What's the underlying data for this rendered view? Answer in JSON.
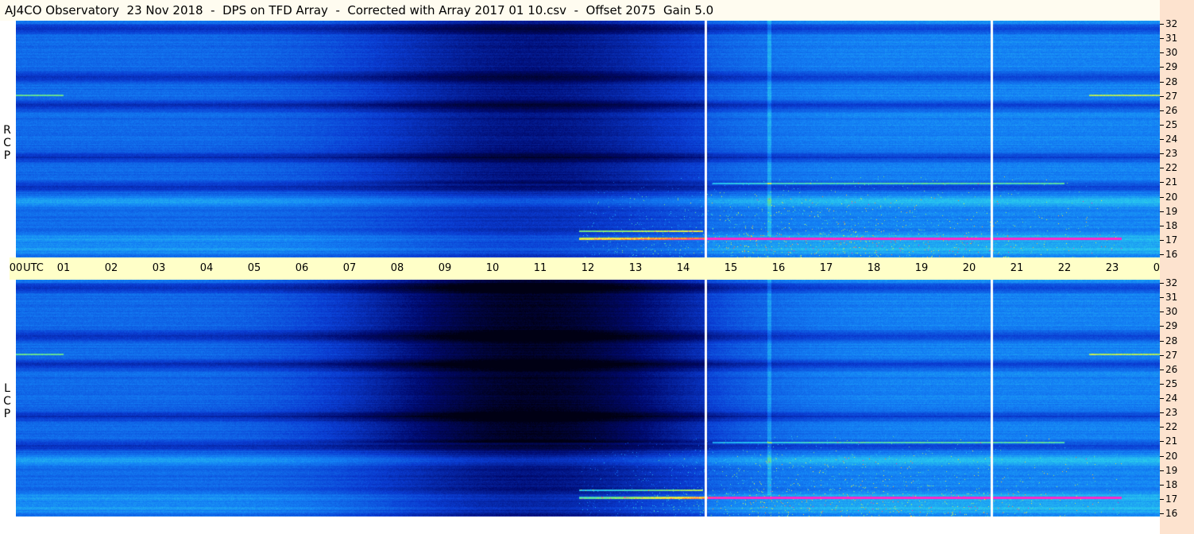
{
  "title": "AJ4CO Observatory  23 Nov 2018  -  DPS on TFD Array  -  Corrected with Array 2017 01 10.csv  -  Offset 2075  Gain 5.0",
  "colors": {
    "title_bg": "#fffcf0",
    "axis_bg": "#ffffc8",
    "freq_strip_bg": "#fde3cf",
    "marker_line": "#ffffff"
  },
  "chart_data": {
    "type": "heatmap",
    "time_axis": {
      "tick_labels": [
        "00",
        "UTC",
        "01",
        "02",
        "03",
        "04",
        "05",
        "06",
        "07",
        "08",
        "09",
        "10",
        "11",
        "12",
        "13",
        "14",
        "15",
        "16",
        "17",
        "18",
        "19",
        "20",
        "21",
        "22",
        "23",
        "00",
        "MHz"
      ],
      "range_utc_hours": [
        0,
        24
      ]
    },
    "panels": [
      {
        "polarization": "R C P",
        "yticks_mhz": [
          16,
          17,
          18,
          19,
          20,
          21,
          22,
          23,
          24,
          25,
          26,
          27,
          28,
          29,
          30,
          31,
          32
        ],
        "ylim_mhz": [
          16,
          32
        ]
      },
      {
        "polarization": "L C P",
        "yticks_mhz": [
          16,
          17,
          18,
          19,
          20,
          21,
          22,
          23,
          24,
          25,
          26,
          27,
          28,
          29,
          30,
          31,
          32
        ],
        "ylim_mhz": [
          16,
          32
        ]
      }
    ],
    "vertical_markers_utc": [
      14.45,
      20.45
    ]
  }
}
